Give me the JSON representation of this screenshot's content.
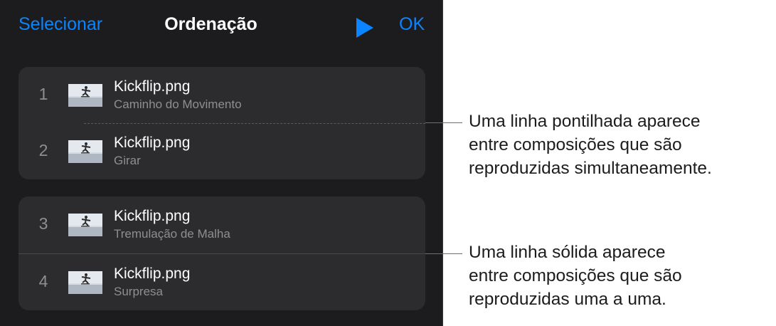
{
  "nav": {
    "select_label": "Selecionar",
    "title": "Ordenação",
    "ok_label": "OK",
    "play_icon": "play-icon"
  },
  "colors": {
    "panel_background": "#1c1c1e",
    "group_background": "#2c2c2e",
    "accent": "#0a84ff",
    "secondary_text": "#8e8e93"
  },
  "groups": [
    {
      "rows": [
        {
          "number": "1",
          "title": "Kickflip.png",
          "subtitle": "Caminho do Movimento"
        },
        {
          "number": "2",
          "title": "Kickflip.png",
          "subtitle": "Girar"
        }
      ]
    },
    {
      "rows": [
        {
          "number": "3",
          "title": "Kickflip.png",
          "subtitle": "Tremulação de Malha"
        },
        {
          "number": "4",
          "title": "Kickflip.png",
          "subtitle": "Surpresa"
        }
      ]
    }
  ],
  "callouts": {
    "dotted": {
      "lines": [
        "Uma linha pontilhada aparece",
        "entre composições que são",
        "reproduzidas simultaneamente."
      ]
    },
    "solid": {
      "lines": [
        "Uma linha sólida aparece",
        "entre composições que são",
        "reproduzidas uma a uma."
      ]
    }
  }
}
